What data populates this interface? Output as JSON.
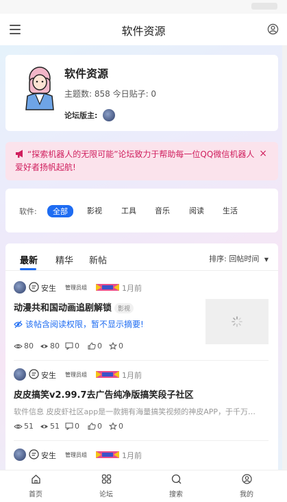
{
  "header": {
    "title": "软件资源"
  },
  "forum": {
    "name": "软件资源",
    "stats": "主题数: 858 今日贴子: 0",
    "moderator_label": "论坛版主:"
  },
  "notice": {
    "text": "“探索机器人的无限可能”论坛致力于帮助每一位QQ微信机器人爱好者扬帆起航!",
    "close": "×"
  },
  "categories": {
    "label": "软件:",
    "items": [
      "全部",
      "影视",
      "工具",
      "音乐",
      "阅读",
      "生活"
    ],
    "active": "全部"
  },
  "feed": {
    "tabs": [
      "最新",
      "精华",
      "新帖"
    ],
    "sort_label": "排序:",
    "sort_value": "回帖时间",
    "posts": [
      {
        "author": "安生",
        "role": "管理员组",
        "time": "1月前",
        "title": "动漫共和国动画追剧解锁",
        "tag": "影视",
        "locked_text": "该帖含阅读权限，暂不显示摘要!",
        "stats": {
          "views": "80",
          "eyes": "80",
          "comments": "0",
          "likes": "0",
          "stars": "0"
        }
      },
      {
        "author": "安生",
        "role": "管理员组",
        "time": "1月前",
        "title": "皮皮搞笑v2.99.7去广告纯净版搞笑段子社区",
        "excerpt": "软件信息 皮皮虾社区app是一款拥有海量搞笑视频的神皮APP，于千万…",
        "stats": {
          "views": "51",
          "eyes": "51",
          "comments": "0",
          "likes": "0",
          "stars": "0"
        }
      },
      {
        "author": "安生",
        "role": "管理员组",
        "time": "1月前"
      }
    ]
  },
  "bottom_nav": [
    {
      "label": "首页",
      "icon": "home-icon"
    },
    {
      "label": "论坛",
      "icon": "grid-icon"
    },
    {
      "label": "搜索",
      "icon": "search-icon"
    },
    {
      "label": "我的",
      "icon": "user-icon"
    }
  ],
  "colors": {
    "accent": "#1e6cf2",
    "notice": "#d01f5e",
    "notice_bg": "#fbe3ec"
  }
}
